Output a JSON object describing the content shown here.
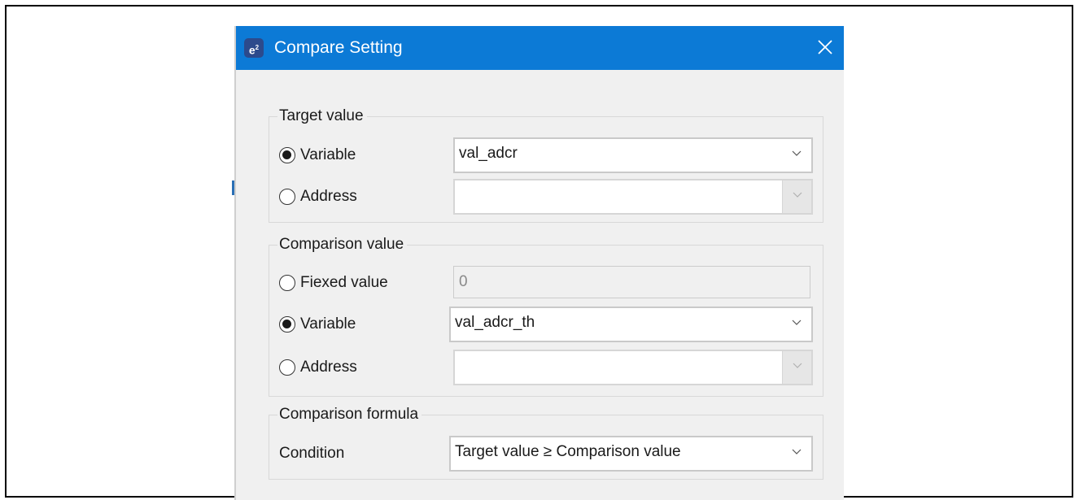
{
  "dialog": {
    "title": "Compare Setting",
    "app_icon": "e²"
  },
  "target": {
    "group_label": "Target value",
    "variable_label": "Variable",
    "variable_value": "val_adcr",
    "address_label": "Address",
    "address_value": ""
  },
  "comparison": {
    "group_label": "Comparison value",
    "fixed_label": "Fiexed value",
    "fixed_value": "0",
    "variable_label": "Variable",
    "variable_value": "val_adcr_th",
    "address_label": "Address",
    "address_value": ""
  },
  "formula": {
    "group_label": "Comparison formula",
    "condition_label": "Condition",
    "condition_value": "Target value ≥ Comparison value"
  },
  "icons": {
    "close": "close-icon",
    "dropdown": "chevron-down-icon"
  },
  "colors": {
    "titlebar": "#0c7ad6",
    "dialog_bg": "#f0f0f0"
  }
}
